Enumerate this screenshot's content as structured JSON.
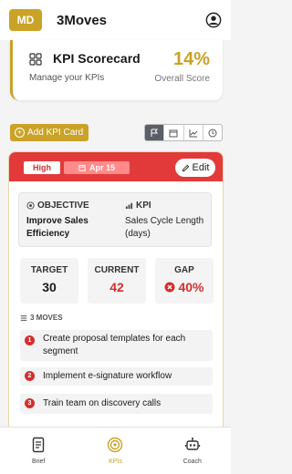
{
  "header": {
    "avatar_initials": "MD",
    "app_title": "3Moves"
  },
  "scorecard": {
    "title": "KPI Scorecard",
    "subtitle": "Manage your KPIs",
    "score": "14%",
    "score_label": "Overall Score"
  },
  "toolbar": {
    "add_label": "Add KPI Card",
    "views": [
      "flag-icon",
      "calendar-icon",
      "chart-icon",
      "clock-icon"
    ],
    "active_view": 0
  },
  "card": {
    "priority": "High",
    "date": "Apr 15",
    "edit_label": "Edit",
    "objective_label": "OBJECTIVE",
    "objective": "Improve Sales Efficiency",
    "kpi_label": "KPI",
    "kpi": "Sales Cycle Length (days)",
    "metrics": [
      {
        "label": "TARGET",
        "value": "30",
        "color": "#1a1a1a"
      },
      {
        "label": "CURRENT",
        "value": "42",
        "color": "#d32f2f"
      },
      {
        "label": "GAP",
        "value": "40%",
        "color": "#d32f2f"
      }
    ],
    "moves_label": "3 MOVES",
    "moves": [
      {
        "num": "1",
        "text": "Create proposal templates for each segment"
      },
      {
        "num": "2",
        "text": "Implement e-signature workflow"
      },
      {
        "num": "3",
        "text": "Train team on discovery calls"
      }
    ]
  },
  "nav": [
    {
      "label": "Brief",
      "icon": "document-icon"
    },
    {
      "label": "KPIs",
      "icon": "target-icon"
    },
    {
      "label": "Coach",
      "icon": "robot-icon"
    }
  ],
  "colors": {
    "gold": "#c9a227",
    "red": "#e23a3a"
  }
}
